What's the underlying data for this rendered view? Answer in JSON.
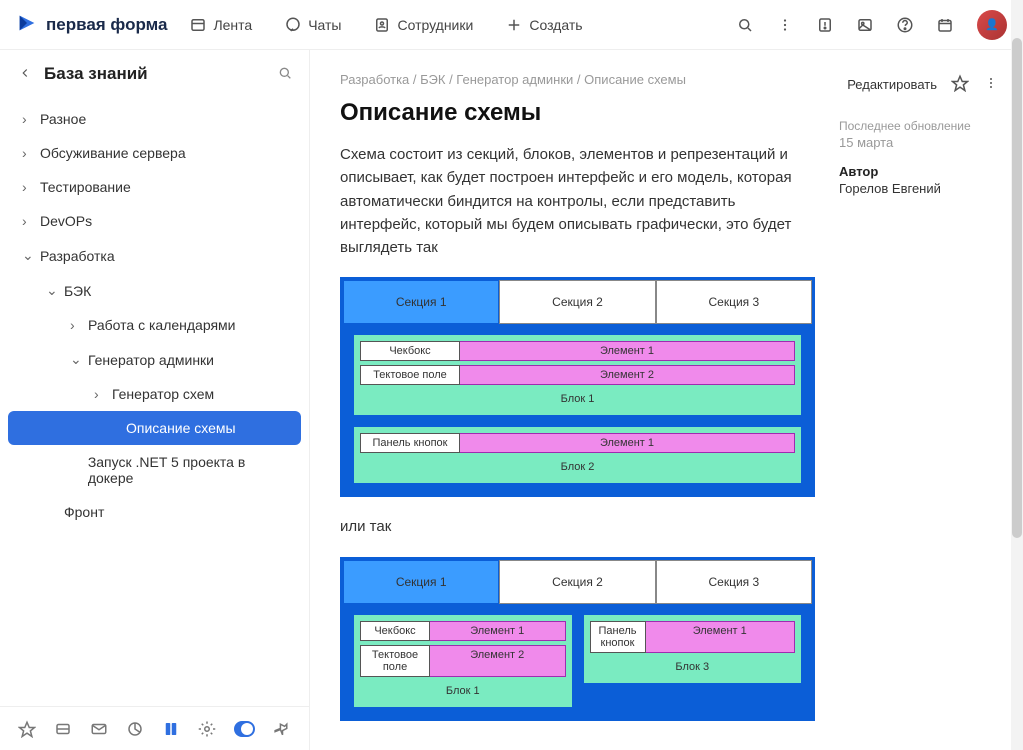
{
  "brand": "первая форма",
  "nav": {
    "feed": "Лента",
    "chats": "Чаты",
    "employees": "Сотрудники",
    "create": "Создать"
  },
  "sidebar": {
    "title": "База знаний",
    "items": [
      {
        "label": "Разное",
        "lvl": 0,
        "open": false
      },
      {
        "label": "Обсуживание сервера",
        "lvl": 0,
        "open": false
      },
      {
        "label": "Тестирование",
        "lvl": 0,
        "open": false
      },
      {
        "label": "DevOPs",
        "lvl": 0,
        "open": false
      },
      {
        "label": "Разработка",
        "lvl": 0,
        "open": true
      },
      {
        "label": "БЭК",
        "lvl": 1,
        "open": true
      },
      {
        "label": "Работа с календарями",
        "lvl": 2,
        "open": false
      },
      {
        "label": "Генератор админки",
        "lvl": 2,
        "open": true
      },
      {
        "label": "Генератор схем",
        "lvl": 3,
        "open": false
      },
      {
        "label": "Описание схемы",
        "lvl": 3,
        "active": true,
        "leaf": true
      },
      {
        "label": "Запуск .NET 5 проекта в докере",
        "lvl": 2,
        "leaf": true
      },
      {
        "label": "Фронт",
        "lvl": 1,
        "leaf": true
      }
    ]
  },
  "breadcrumb": [
    "Разработка",
    "БЭК",
    "Генератор админки",
    "Описание схемы"
  ],
  "page": {
    "title": "Описание схемы",
    "para1": "Схема состоит из секций, блоков, элементов и репрезентаций и описывает, как будет построен интерфейс и его модель, которая автоматически биндится на контролы, если представить интерфейс, который мы будем описывать графически, это будет выглядеть так",
    "or": "или так"
  },
  "diagram1": {
    "tabs": [
      "Секция 1",
      "Секция 2",
      "Секция 3"
    ],
    "block1": {
      "rows": [
        {
          "label": "Чекбокс",
          "el": "Элемент 1"
        },
        {
          "label": "Тектовое поле",
          "el": "Элемент 2"
        }
      ],
      "name": "Блок 1"
    },
    "block2": {
      "rows": [
        {
          "label": "Панель кнопок",
          "el": "Элемент 1"
        }
      ],
      "name": "Блок 2"
    }
  },
  "diagram2": {
    "tabs": [
      "Секция 1",
      "Секция 2",
      "Секция 3"
    ],
    "left": {
      "rows": [
        {
          "label": "Чекбокс",
          "el": "Элемент 1"
        },
        {
          "label": "Тектовое поле",
          "el": "Элемент 2"
        }
      ],
      "name": "Блок 1"
    },
    "right": {
      "rows": [
        {
          "label": "Панель кнопок",
          "el": "Элемент 1"
        }
      ],
      "name": "Блок 3"
    }
  },
  "meta": {
    "edit": "Редактировать",
    "updated_label": "Последнее обновление",
    "updated_val": "15 марта",
    "author_label": "Автор",
    "author_val": "Горелов Евгений"
  }
}
